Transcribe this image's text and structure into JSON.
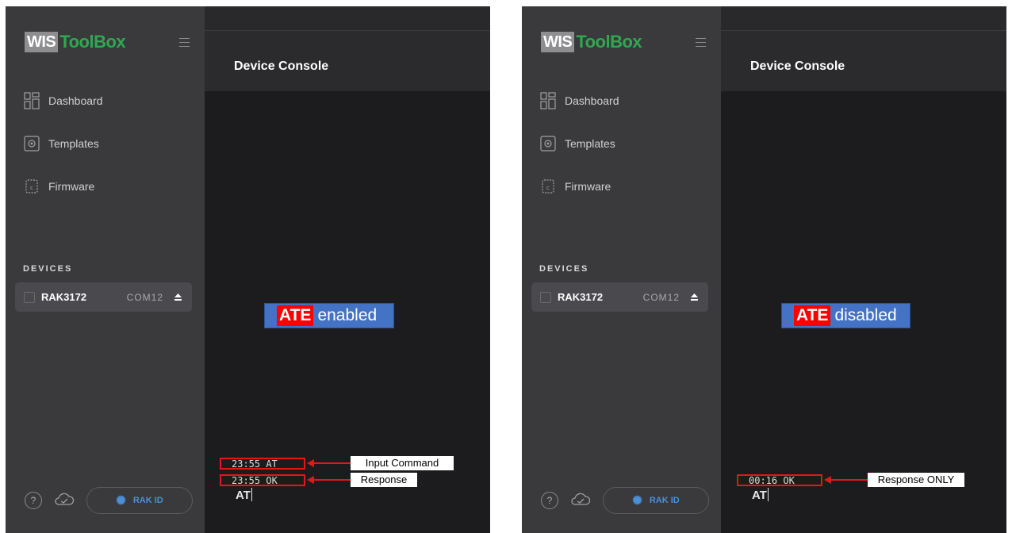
{
  "app": {
    "logo_wis": "WIS",
    "logo_toolbox": "ToolBox",
    "page_title": "Device Console",
    "nav": [
      {
        "label": "Dashboard",
        "icon": "dashboard-icon"
      },
      {
        "label": "Templates",
        "icon": "templates-icon"
      },
      {
        "label": "Firmware",
        "icon": "firmware-icon"
      }
    ],
    "devices_heading": "DEVICES",
    "device": {
      "name": "RAK3172",
      "port": "COM12"
    },
    "help_label": "?",
    "rakid_label": "RAK ID"
  },
  "panels": {
    "left": {
      "ate_prefix": "ATE",
      "ate_state": "enabled",
      "log": [
        "23:55  AT",
        "23:55  OK"
      ],
      "input_value": "AT",
      "callouts": [
        "Input Command",
        "Response"
      ]
    },
    "right": {
      "ate_prefix": "ATE",
      "ate_state": "disabled",
      "log": [
        "00:16  OK"
      ],
      "input_value": "AT",
      "callouts": [
        "Response ONLY"
      ]
    }
  },
  "colors": {
    "brand_green": "#2fa84f",
    "annotation_red": "#e21818",
    "badge_blue": "#4472c4",
    "link_blue": "#4a90d9"
  }
}
